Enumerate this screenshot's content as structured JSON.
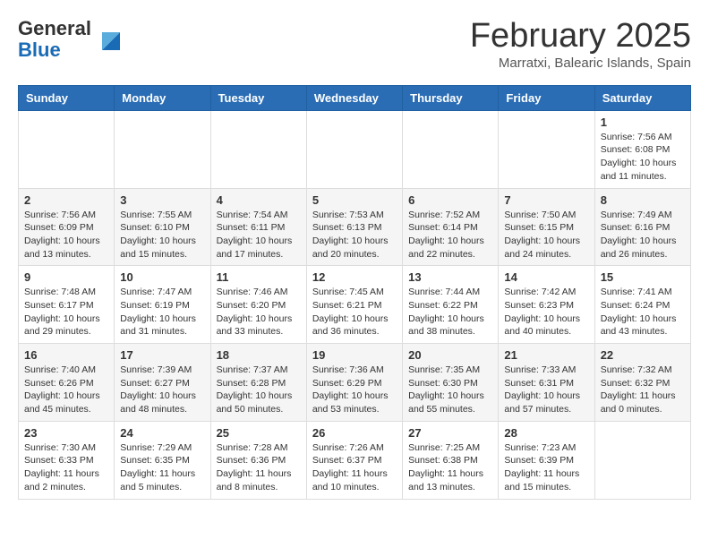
{
  "header": {
    "logo_general": "General",
    "logo_blue": "Blue",
    "month_title": "February 2025",
    "subtitle": "Marratxi, Balearic Islands, Spain"
  },
  "days_of_week": [
    "Sunday",
    "Monday",
    "Tuesday",
    "Wednesday",
    "Thursday",
    "Friday",
    "Saturday"
  ],
  "weeks": [
    [
      {
        "day": "",
        "info": ""
      },
      {
        "day": "",
        "info": ""
      },
      {
        "day": "",
        "info": ""
      },
      {
        "day": "",
        "info": ""
      },
      {
        "day": "",
        "info": ""
      },
      {
        "day": "",
        "info": ""
      },
      {
        "day": "1",
        "info": "Sunrise: 7:56 AM\nSunset: 6:08 PM\nDaylight: 10 hours and 11 minutes."
      }
    ],
    [
      {
        "day": "2",
        "info": "Sunrise: 7:56 AM\nSunset: 6:09 PM\nDaylight: 10 hours and 13 minutes."
      },
      {
        "day": "3",
        "info": "Sunrise: 7:55 AM\nSunset: 6:10 PM\nDaylight: 10 hours and 15 minutes."
      },
      {
        "day": "4",
        "info": "Sunrise: 7:54 AM\nSunset: 6:11 PM\nDaylight: 10 hours and 17 minutes."
      },
      {
        "day": "5",
        "info": "Sunrise: 7:53 AM\nSunset: 6:13 PM\nDaylight: 10 hours and 20 minutes."
      },
      {
        "day": "6",
        "info": "Sunrise: 7:52 AM\nSunset: 6:14 PM\nDaylight: 10 hours and 22 minutes."
      },
      {
        "day": "7",
        "info": "Sunrise: 7:50 AM\nSunset: 6:15 PM\nDaylight: 10 hours and 24 minutes."
      },
      {
        "day": "8",
        "info": "Sunrise: 7:49 AM\nSunset: 6:16 PM\nDaylight: 10 hours and 26 minutes."
      }
    ],
    [
      {
        "day": "9",
        "info": "Sunrise: 7:48 AM\nSunset: 6:17 PM\nDaylight: 10 hours and 29 minutes."
      },
      {
        "day": "10",
        "info": "Sunrise: 7:47 AM\nSunset: 6:19 PM\nDaylight: 10 hours and 31 minutes."
      },
      {
        "day": "11",
        "info": "Sunrise: 7:46 AM\nSunset: 6:20 PM\nDaylight: 10 hours and 33 minutes."
      },
      {
        "day": "12",
        "info": "Sunrise: 7:45 AM\nSunset: 6:21 PM\nDaylight: 10 hours and 36 minutes."
      },
      {
        "day": "13",
        "info": "Sunrise: 7:44 AM\nSunset: 6:22 PM\nDaylight: 10 hours and 38 minutes."
      },
      {
        "day": "14",
        "info": "Sunrise: 7:42 AM\nSunset: 6:23 PM\nDaylight: 10 hours and 40 minutes."
      },
      {
        "day": "15",
        "info": "Sunrise: 7:41 AM\nSunset: 6:24 PM\nDaylight: 10 hours and 43 minutes."
      }
    ],
    [
      {
        "day": "16",
        "info": "Sunrise: 7:40 AM\nSunset: 6:26 PM\nDaylight: 10 hours and 45 minutes."
      },
      {
        "day": "17",
        "info": "Sunrise: 7:39 AM\nSunset: 6:27 PM\nDaylight: 10 hours and 48 minutes."
      },
      {
        "day": "18",
        "info": "Sunrise: 7:37 AM\nSunset: 6:28 PM\nDaylight: 10 hours and 50 minutes."
      },
      {
        "day": "19",
        "info": "Sunrise: 7:36 AM\nSunset: 6:29 PM\nDaylight: 10 hours and 53 minutes."
      },
      {
        "day": "20",
        "info": "Sunrise: 7:35 AM\nSunset: 6:30 PM\nDaylight: 10 hours and 55 minutes."
      },
      {
        "day": "21",
        "info": "Sunrise: 7:33 AM\nSunset: 6:31 PM\nDaylight: 10 hours and 57 minutes."
      },
      {
        "day": "22",
        "info": "Sunrise: 7:32 AM\nSunset: 6:32 PM\nDaylight: 11 hours and 0 minutes."
      }
    ],
    [
      {
        "day": "23",
        "info": "Sunrise: 7:30 AM\nSunset: 6:33 PM\nDaylight: 11 hours and 2 minutes."
      },
      {
        "day": "24",
        "info": "Sunrise: 7:29 AM\nSunset: 6:35 PM\nDaylight: 11 hours and 5 minutes."
      },
      {
        "day": "25",
        "info": "Sunrise: 7:28 AM\nSunset: 6:36 PM\nDaylight: 11 hours and 8 minutes."
      },
      {
        "day": "26",
        "info": "Sunrise: 7:26 AM\nSunset: 6:37 PM\nDaylight: 11 hours and 10 minutes."
      },
      {
        "day": "27",
        "info": "Sunrise: 7:25 AM\nSunset: 6:38 PM\nDaylight: 11 hours and 13 minutes."
      },
      {
        "day": "28",
        "info": "Sunrise: 7:23 AM\nSunset: 6:39 PM\nDaylight: 11 hours and 15 minutes."
      },
      {
        "day": "",
        "info": ""
      }
    ]
  ]
}
